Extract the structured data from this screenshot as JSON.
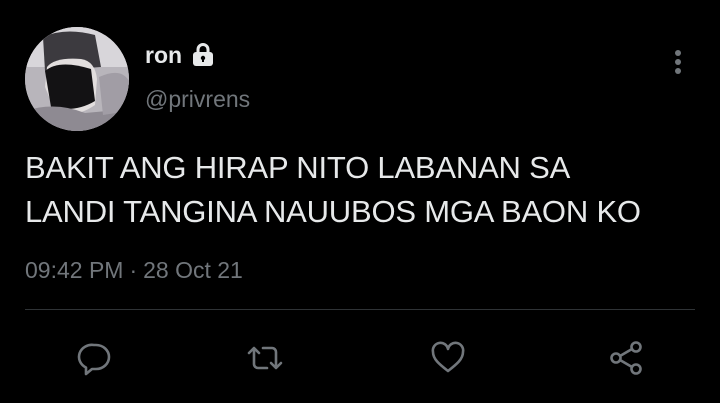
{
  "user": {
    "display_name": "ron",
    "handle": "@privrens",
    "protected_icon": "lock-icon",
    "avatar": "profile-photo"
  },
  "tweet": {
    "text": "BAKIT ANG HIRAP NITO LABANAN SA\nLANDI TANGINA NAUUBOS MGA BAON KO",
    "time": "09:42 PM",
    "separator": "·",
    "date": "28 Oct 21"
  },
  "menu_icon": "more-vertical-icon",
  "actions": [
    {
      "icon": "reply-icon"
    },
    {
      "icon": "retweet-icon"
    },
    {
      "icon": "like-icon"
    },
    {
      "icon": "share-icon"
    }
  ],
  "colors": {
    "background": "#000000",
    "text_primary": "#e7e9ea",
    "text_secondary": "#71767b",
    "divider": "#2f3336"
  }
}
